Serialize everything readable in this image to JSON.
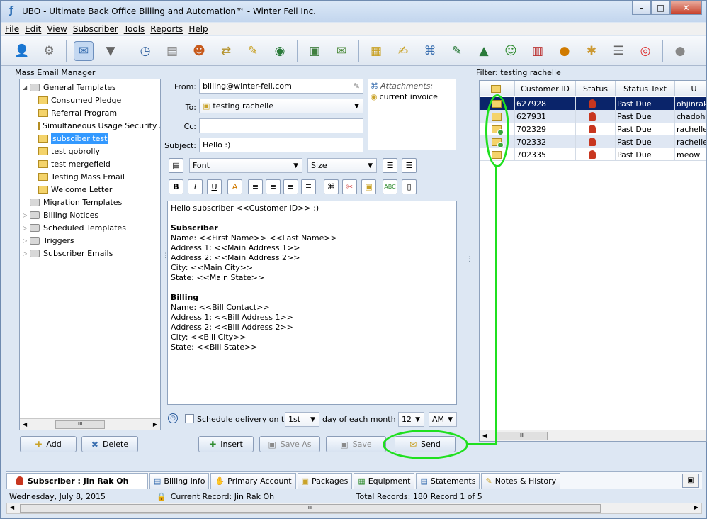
{
  "window": {
    "title": "UBO - Ultimate Back Office Billing and Automation™  - Winter Fell Inc.",
    "buttons": {
      "minimize": "–",
      "maximize": "□",
      "close": "✕"
    }
  },
  "menu": [
    "File",
    "Edit",
    "View",
    "Subscriber",
    "Tools",
    "Reports",
    "Help"
  ],
  "toolbar_icons": [
    "add-user-icon",
    "gears-icon",
    "save-mail-icon",
    "filter-icon",
    "clock-icon",
    "document-icon",
    "users-icon",
    "transfer-icon",
    "edit-icon",
    "globe-icon",
    "box-icon",
    "email-icon",
    "note-icon",
    "note-edit-icon",
    "paperclip-icon",
    "chart-edit-icon",
    "chart-icon",
    "support-icon",
    "mailbox-icon",
    "spam-icon",
    "bug-icon",
    "checklist-icon",
    "lifebuoy-icon",
    "person-icon"
  ],
  "left_panel": {
    "title": "Mass Email Manager",
    "tree": [
      {
        "label": "General Templates",
        "type": "folder",
        "level": 0,
        "expanded": true
      },
      {
        "label": "Consumed Pledge",
        "type": "template",
        "level": 1
      },
      {
        "label": "Referral Program",
        "type": "template",
        "level": 1
      },
      {
        "label": "Simultaneous Usage Security Ale",
        "type": "template",
        "level": 1
      },
      {
        "label": "subsciber test",
        "type": "template",
        "level": 1,
        "selected": true
      },
      {
        "label": "test gobrolly",
        "type": "template",
        "level": 1
      },
      {
        "label": "test mergefield",
        "type": "template",
        "level": 1
      },
      {
        "label": "Testing Mass Email",
        "type": "template",
        "level": 1
      },
      {
        "label": "Welcome Letter",
        "type": "template",
        "level": 1
      },
      {
        "label": "Migration Templates",
        "type": "folder",
        "level": 0
      },
      {
        "label": "Billing Notices",
        "type": "folder",
        "level": 0,
        "collapsed": true
      },
      {
        "label": "Scheduled Templates",
        "type": "folder",
        "level": 0,
        "collapsed": true
      },
      {
        "label": "Triggers",
        "type": "folder",
        "level": 0,
        "collapsed": true
      },
      {
        "label": "Subscriber Emails",
        "type": "folder",
        "level": 0,
        "collapsed": true
      }
    ],
    "buttons": {
      "add": "Add",
      "delete": "Delete"
    },
    "scroll_label": "III"
  },
  "compose": {
    "from_label": "From:",
    "from_value": "billing@winter-fell.com",
    "to_label": "To:",
    "to_value": "testing rachelle",
    "cc_label": "Cc:",
    "cc_value": "",
    "subject_label": "Subject:",
    "subject_value": "Hello :)",
    "attachments_label": "Attachments:",
    "attachment_item": "current invoice",
    "font_placeholder": "Font",
    "size_placeholder": "Size",
    "format_buttons": {
      "bold": "B",
      "italic": "I",
      "underline": "U"
    },
    "body": [
      {
        "text": "Hello subscriber <<Customer ID>> :)",
        "bold": false
      },
      {
        "text": "",
        "bold": false
      },
      {
        "text": "Subscriber",
        "bold": true
      },
      {
        "text": "Name: <<First Name>> <<Last Name>>",
        "bold": false
      },
      {
        "text": "Address 1: <<Main Address 1>>",
        "bold": false
      },
      {
        "text": "Address 2: <<Main Address 2>>",
        "bold": false
      },
      {
        "text": "City: <<Main City>>",
        "bold": false
      },
      {
        "text": "State: <<Main State>>",
        "bold": false
      },
      {
        "text": "",
        "bold": false
      },
      {
        "text": "Billing",
        "bold": true
      },
      {
        "text": "Name: <<Bill Contact>>",
        "bold": false
      },
      {
        "text": "Address 1: <<Bill Address 1>>",
        "bold": false
      },
      {
        "text": "Address 2: <<Bill Address 2>>",
        "bold": false
      },
      {
        "text": "City: <<Bill City>>",
        "bold": false
      },
      {
        "text": "State: <<Bill State>>",
        "bold": false
      }
    ],
    "schedule_label": "Schedule delivery on the",
    "schedule_day": "1st",
    "schedule_mid": "day of each month at",
    "schedule_hour": "12",
    "schedule_ampm": "AM",
    "buttons": {
      "insert": "Insert",
      "save_as": "Save As",
      "save": "Save",
      "send": "Send"
    }
  },
  "right_panel": {
    "filter_label": "Filter: testing rachelle",
    "columns": [
      "",
      "Customer ID",
      "Status",
      "Status Text",
      "U"
    ],
    "rows": [
      {
        "icon": "envelope",
        "customer_id": "627928",
        "status_text": "Past Due",
        "user": "ohjinrak",
        "selected": true
      },
      {
        "icon": "envelope",
        "customer_id": "627931",
        "status_text": "Past Due",
        "user": "chadohv",
        "alt": true
      },
      {
        "icon": "envelope-check",
        "customer_id": "702329",
        "status_text": "Past Due",
        "user": "rachelle_"
      },
      {
        "icon": "envelope-check",
        "customer_id": "702332",
        "status_text": "Past Due",
        "user": "rachelle_",
        "alt": true
      },
      {
        "icon": "envelope",
        "customer_id": "702335",
        "status_text": "Past Due",
        "user": "meow"
      }
    ],
    "scroll_label": "III"
  },
  "bottom_tabs": {
    "active": "Subscriber : Jin Rak Oh",
    "tabs": [
      "Billing Info",
      "Primary Account",
      "Packages",
      "Equipment",
      "Statements",
      "Notes & History"
    ]
  },
  "status": {
    "date": "Wednesday, July 8, 2015",
    "current_record": "Current Record: Jin Rak Oh",
    "total_records": "Total Records: 180",
    "record_position": "Record 1 of 5"
  },
  "colors": {
    "annotation": "#1fe01f",
    "selection": "#0a246a",
    "tree_selection": "#3399ff"
  }
}
